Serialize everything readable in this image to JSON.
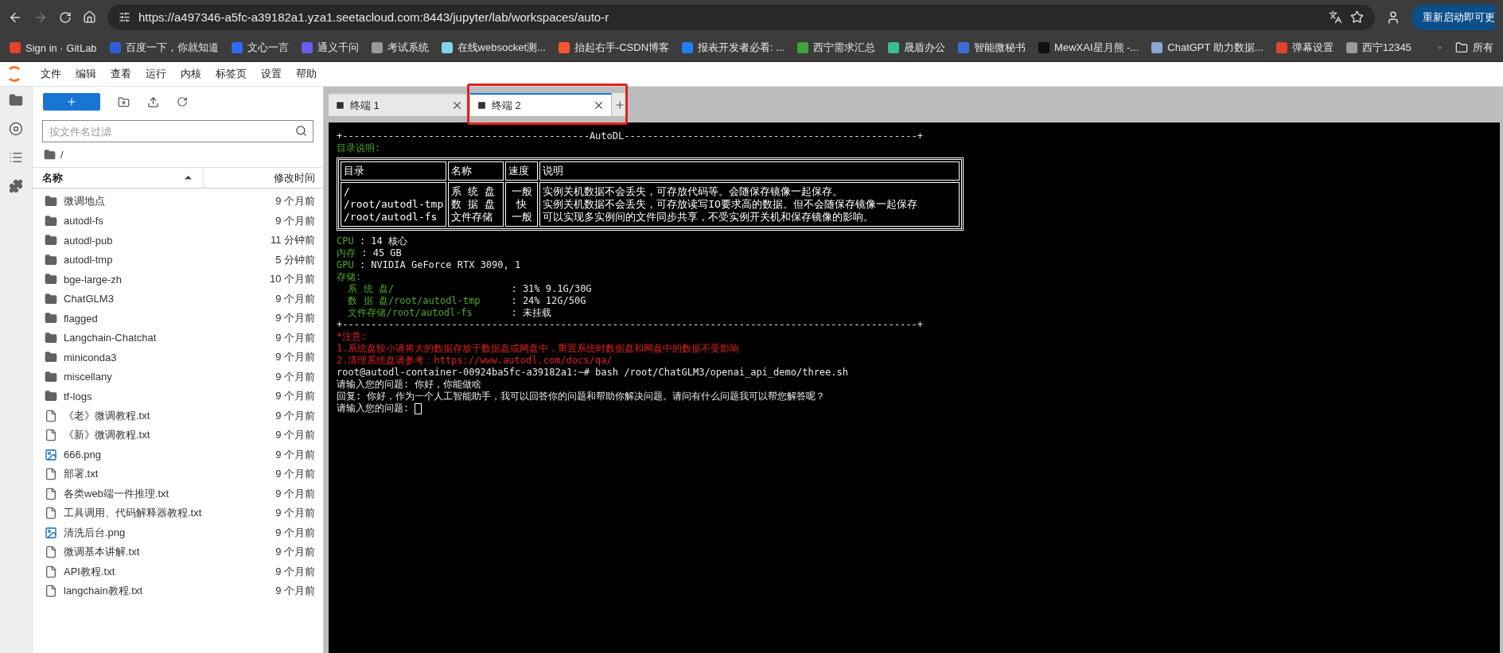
{
  "browser": {
    "url": "https://a497346-a5fc-a39182a1.yza1.seetacloud.com:8443/jupyter/lab/workspaces/auto-r",
    "update_button": "重新启动即可更",
    "bookmarks": [
      {
        "label": "Sign in · GitLab",
        "color": "#e24329"
      },
      {
        "label": "百度一下，你就知道",
        "color": "#2f5fd8"
      },
      {
        "label": "文心一言",
        "color": "#2b6cf0"
      },
      {
        "label": "通义千问",
        "color": "#6b5cf0"
      },
      {
        "label": "考试系统",
        "color": "#9a9a9a"
      },
      {
        "label": "在线websocket测...",
        "color": "#7fd6e8"
      },
      {
        "label": "抬起右手-CSDN博客",
        "color": "#fc5531"
      },
      {
        "label": "报表开发者必看: ...",
        "color": "#1e80ff"
      },
      {
        "label": "西宁需求汇总",
        "color": "#3fa33a"
      },
      {
        "label": "晟盾办公",
        "color": "#3bbf8f"
      },
      {
        "label": "智能微秘书",
        "color": "#3b6fd8"
      },
      {
        "label": "MewXAI星月熊 -...",
        "color": "#111111"
      },
      {
        "label": "ChatGPT 助力数据...",
        "color": "#8aa6d8"
      },
      {
        "label": "弹幕设置",
        "color": "#e0452c"
      },
      {
        "label": "西宁12345",
        "color": "#9a9a9a"
      }
    ],
    "folder_label": "所有"
  },
  "menu": [
    "文件",
    "编辑",
    "查看",
    "运行",
    "内核",
    "标签页",
    "设置",
    "帮助"
  ],
  "file_browser": {
    "filter_placeholder": "按文件名过滤",
    "path": "/",
    "columns": [
      "名称",
      "修改时间"
    ],
    "items": [
      {
        "kind": "folder",
        "name": "微调地点",
        "modified": "9 个月前"
      },
      {
        "kind": "folder",
        "name": "autodl-fs",
        "modified": "9 个月前"
      },
      {
        "kind": "folder",
        "name": "autodl-pub",
        "modified": "11 分钟前"
      },
      {
        "kind": "folder",
        "name": "autodl-tmp",
        "modified": "5 分钟前"
      },
      {
        "kind": "folder",
        "name": "bge-large-zh",
        "modified": "10 个月前"
      },
      {
        "kind": "folder",
        "name": "ChatGLM3",
        "modified": "9 个月前"
      },
      {
        "kind": "folder",
        "name": "flagged",
        "modified": "9 个月前"
      },
      {
        "kind": "folder",
        "name": "Langchain-Chatchat",
        "modified": "9 个月前"
      },
      {
        "kind": "folder",
        "name": "miniconda3",
        "modified": "9 个月前"
      },
      {
        "kind": "folder",
        "name": "miscellany",
        "modified": "9 个月前"
      },
      {
        "kind": "folder",
        "name": "tf-logs",
        "modified": "9 个月前"
      },
      {
        "kind": "file",
        "name": "《老》微调教程.txt",
        "modified": "9 个月前"
      },
      {
        "kind": "file",
        "name": "《新》微调教程.txt",
        "modified": "9 个月前"
      },
      {
        "kind": "image",
        "name": "666.png",
        "modified": "9 个月前"
      },
      {
        "kind": "file",
        "name": "部署.txt",
        "modified": "9 个月前"
      },
      {
        "kind": "file",
        "name": "各类web端一件推理.txt",
        "modified": "9 个月前"
      },
      {
        "kind": "file",
        "name": "工具调用、代码解释器教程.txt",
        "modified": "9 个月前"
      },
      {
        "kind": "image",
        "name": "清洗后台.png",
        "modified": "9 个月前"
      },
      {
        "kind": "file",
        "name": "微调基本讲解.txt",
        "modified": "9 个月前"
      },
      {
        "kind": "file",
        "name": "API教程.txt",
        "modified": "9 个月前"
      },
      {
        "kind": "file",
        "name": "langchain教程.txt",
        "modified": "9 个月前"
      }
    ]
  },
  "tabs": [
    {
      "label": "终端 1",
      "selected": false,
      "highlighted": false
    },
    {
      "label": "终端 2",
      "selected": true,
      "highlighted": true
    }
  ],
  "terminal": {
    "banner_top": "+-------------------------------------------AutoDL---------------------------------------------------+",
    "section_label": "目录说明:",
    "table": {
      "header": [
        "目录",
        "名称",
        "速度",
        "说明"
      ],
      "row": [
        [
          "/",
          "/root/autodl-tmp",
          "/root/autodl-fs"
        ],
        [
          "系 统 盘",
          "数 据 盘",
          "文件存储"
        ],
        [
          "一般",
          "快",
          "一般"
        ],
        [
          "实例关机数据不会丢失，可存放代码等。会随保存镜像一起保存。",
          "实例关机数据不会丢失，可存放读写IO要求高的数据。但不会随保存镜像一起保存",
          "可以实现多实例间的文件同步共享，不受实例开关机和保存镜像的影响。"
        ]
      ]
    },
    "specs": [
      {
        "label": "CPU",
        "value": ": 14 核心"
      },
      {
        "label": "内存",
        "value": ": 45 GB"
      },
      {
        "label": "GPU",
        "value": ": NVIDIA GeForce RTX 3090, 1"
      }
    ],
    "storage_label": "存储:",
    "storage": [
      {
        "label": "系 统 盘/",
        "value": ": 31% 9.1G/30G"
      },
      {
        "label": "数 据 盘/root/autodl-tmp",
        "value": ": 24% 12G/50G"
      },
      {
        "label": "文件存储/root/autodl-fs",
        "value": ": 未挂载"
      }
    ],
    "banner_bottom": "+----------------------------------------------------------------------------------------------------+",
    "notes": [
      "*注意:",
      "1.系统盘较小请将大的数据存放于数据盘或网盘中，重置系统时数据盘和网盘中的数据不受影响",
      "2.清理系统盘请参考：https://www.autodl.com/docs/qa/"
    ],
    "lines": [
      "root@autodl-container-00924ba5fc-a39182a1:~# bash /root/ChatGLM3/openai_api_demo/three.sh",
      "请输入您的问题: 你好，你能做啥",
      "回复: 你好，作为一个人工智能助手，我可以回答你的问题和帮助你解决问题。请问有什么问题我可以帮您解答呢？"
    ],
    "prompt": "请输入您的问题: "
  }
}
